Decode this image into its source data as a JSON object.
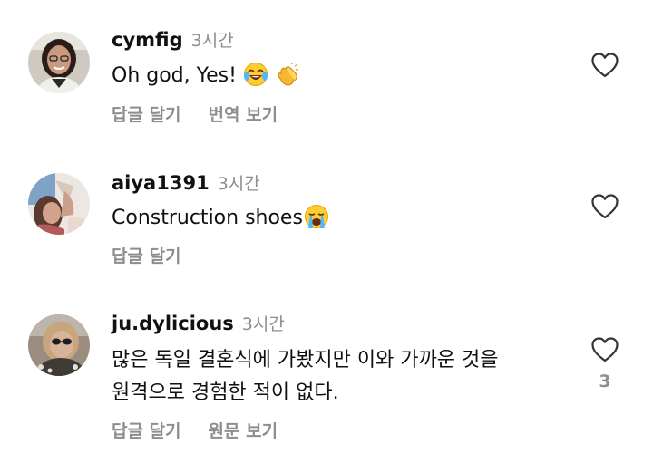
{
  "comments": [
    {
      "username": "cymfig",
      "time": "3시간",
      "text": "Oh god, Yes!",
      "emoji": [
        "face-with-tears-of-joy",
        "clapping-hands"
      ],
      "actions": [
        "답글 달기",
        "번역 보기"
      ],
      "like_count": ""
    },
    {
      "username": "aiya1391",
      "time": "3시간",
      "text": "Construction shoes",
      "emoji": [
        "loudly-crying-face"
      ],
      "actions": [
        "답글 달기"
      ],
      "like_count": ""
    },
    {
      "username": "ju.dylicious",
      "time": "3시간",
      "text_lines": [
        "많은 독일 결혼식에 가봤지만 이와 가까운 것을",
        "원격으로 경험한 적이 없다."
      ],
      "actions": [
        "답글 달기",
        "원문 보기"
      ],
      "like_count": "3"
    }
  ],
  "colors": {
    "text": "#111111",
    "muted": "#8e8e8e",
    "background": "#ffffff"
  }
}
